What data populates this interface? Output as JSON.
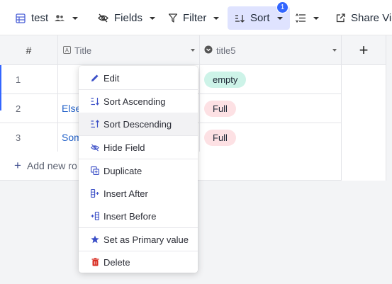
{
  "toolbar": {
    "table_name": "test",
    "fields_label": "Fields",
    "filter_label": "Filter",
    "sort_label": "Sort",
    "sort_badge": "1",
    "share_label": "Share View"
  },
  "grid": {
    "columns": [
      {
        "label": "#"
      },
      {
        "label": "Title"
      },
      {
        "label": "title5"
      }
    ],
    "add_column_label": "+",
    "rows": [
      {
        "num": "1",
        "title": "",
        "title5": "empty",
        "title5_style": "empty"
      },
      {
        "num": "2",
        "title": "Else",
        "title5": "Full",
        "title5_style": "full"
      },
      {
        "num": "3",
        "title": "Som",
        "title5": "Full",
        "title5_style": "full"
      }
    ],
    "add_row_label": "Add new ro"
  },
  "context_menu": {
    "items": [
      {
        "label": "Edit",
        "icon": "pencil-icon"
      },
      {
        "label": "Sort Ascending",
        "icon": "sort-ascending-icon"
      },
      {
        "label": "Sort Descending",
        "icon": "sort-descending-icon"
      },
      {
        "label": "Hide Field",
        "icon": "eye-off-icon"
      },
      {
        "label": "Duplicate",
        "icon": "duplicate-icon"
      },
      {
        "label": "Insert After",
        "icon": "insert-after-icon"
      },
      {
        "label": "Insert Before",
        "icon": "insert-before-icon"
      },
      {
        "label": "Set as Primary value",
        "icon": "star-icon"
      },
      {
        "label": "Delete",
        "icon": "trash-icon"
      }
    ]
  },
  "colors": {
    "accent": "#3366ff",
    "sort_active_bg": "#dfe3ff",
    "pill_empty": "#cdf3e8",
    "pill_full": "#fde1e4",
    "link": "#2563c9",
    "delete_icon": "#d93025"
  }
}
